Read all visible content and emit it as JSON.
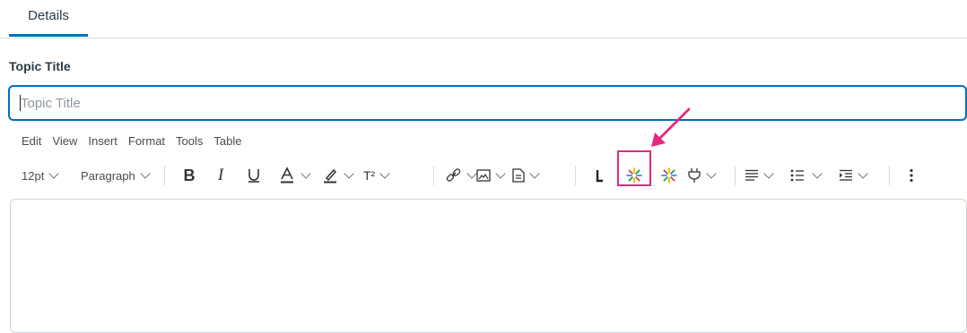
{
  "tabs": [
    {
      "label": "Details"
    }
  ],
  "topic": {
    "label": "Topic Title",
    "placeholder": "Topic Title",
    "value": ""
  },
  "menubar": [
    "Edit",
    "View",
    "Insert",
    "Format",
    "Tools",
    "Table"
  ],
  "toolbar": {
    "font_size": "12pt",
    "block_format": "Paragraph",
    "superscript_label": "T²"
  },
  "colors": {
    "accent": "#006fbf",
    "annotation": "#e6287f",
    "text": "#2d3b45"
  }
}
